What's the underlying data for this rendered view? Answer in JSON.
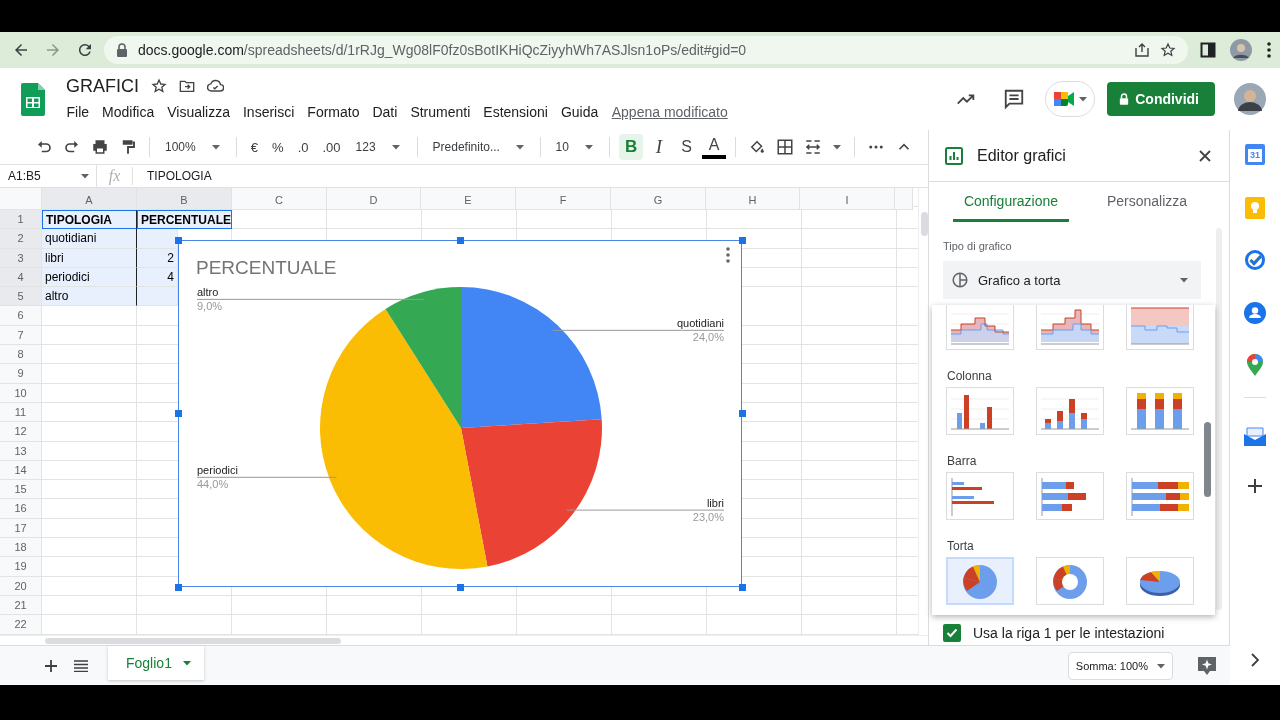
{
  "browser": {
    "url": {
      "host": "docs.google.com",
      "path": "/spreadsheets/d/1rRJg_Wg08lF0fz0sBotIKHiQcZiyyhWh7ASJlsn1oPs/edit#gid=0"
    }
  },
  "doc": {
    "title": "GRAFICI",
    "menus": [
      "File",
      "Modifica",
      "Visualizza",
      "Inserisci",
      "Formato",
      "Dati",
      "Strumenti",
      "Estensioni",
      "Guida"
    ],
    "last_edit": "Appena modificato",
    "share_label": "Condividi"
  },
  "toolbar": {
    "zoom": "100%",
    "currency": "€",
    "percent": "%",
    "decimals_less": ".0",
    "decimals_more": ".00",
    "number_format": "123",
    "font": "Predefinito...",
    "font_size": "10",
    "styles": [
      {
        "kind": "bold",
        "label": "B",
        "active": true
      },
      {
        "kind": "italic",
        "label": "I",
        "active": false
      },
      {
        "kind": "strike",
        "label": "S",
        "active": false
      },
      {
        "kind": "color",
        "label": "A",
        "active": false
      }
    ]
  },
  "formula_bar": {
    "range": "A1:B5",
    "fx": "fx",
    "value": "TIPOLOGIA"
  },
  "grid": {
    "columns": [
      "A",
      "B",
      "C",
      "D",
      "E",
      "F",
      "G",
      "H",
      "I"
    ],
    "row_numbers": [
      "1",
      "2",
      "3",
      "4",
      "5",
      "6",
      "7",
      "8",
      "9",
      "10",
      "11",
      "12",
      "13",
      "14",
      "15",
      "16",
      "17",
      "18",
      "19",
      "20",
      "21",
      "22"
    ],
    "rows": [
      {
        "a": "TIPOLOGIA",
        "b": "PERCENTUALE",
        "selected": true
      },
      {
        "a": "quotidiani",
        "selected": true
      },
      {
        "a": "libri",
        "b": "2",
        "selected": true
      },
      {
        "a": "periodici",
        "b": "4",
        "selected": true
      },
      {
        "a": "altro",
        "selected": true
      }
    ]
  },
  "chart": {
    "chart_data": {
      "type": "pie",
      "title": "PERCENTUALE",
      "categories": [
        "quotidiani",
        "libri",
        "periodici",
        "altro"
      ],
      "values": [
        24,
        23,
        44,
        9
      ],
      "value_labels": [
        "24,0%",
        "23,0%",
        "44,0%",
        "9,0%"
      ]
    }
  },
  "editor": {
    "title": "Editor grafici",
    "tabs": [
      {
        "label": "Configurazione",
        "selected": true
      },
      {
        "label": "Personalizza",
        "selected": false
      }
    ],
    "type_label": "Tipo di grafico",
    "type_value": "Grafico a torta",
    "menu": [
      {
        "kind": "stepped_area",
        "options": [
          {
            "selected": false
          },
          {
            "selected": false
          },
          {
            "selected": false
          }
        ]
      },
      {
        "label": "Colonna",
        "kind": "column",
        "options": [
          {
            "selected": false
          },
          {
            "selected": false
          },
          {
            "selected": false
          }
        ]
      },
      {
        "label": "Barra",
        "kind": "bar",
        "options": [
          {
            "selected": false
          },
          {
            "selected": false
          },
          {
            "selected": false
          }
        ]
      },
      {
        "label": "Torta",
        "kind": "pie",
        "options": [
          {
            "selected": true
          },
          {
            "selected": false
          },
          {
            "selected": false
          }
        ]
      }
    ],
    "header_checkbox": {
      "label": "Usa la riga 1 per le intestazioni",
      "checked": true
    }
  },
  "side_apps": [
    {
      "kind": "calendar",
      "label": "31"
    },
    {
      "kind": "keep"
    },
    {
      "kind": "tasks"
    },
    {
      "kind": "contacts"
    },
    {
      "kind": "maps"
    },
    {
      "kind": "divider"
    },
    {
      "kind": "addon"
    },
    {
      "kind": "add"
    }
  ],
  "bottom": {
    "sheets": [
      {
        "label": "Foglio1",
        "selected": true
      }
    ],
    "sum": "Somma: 100%"
  }
}
